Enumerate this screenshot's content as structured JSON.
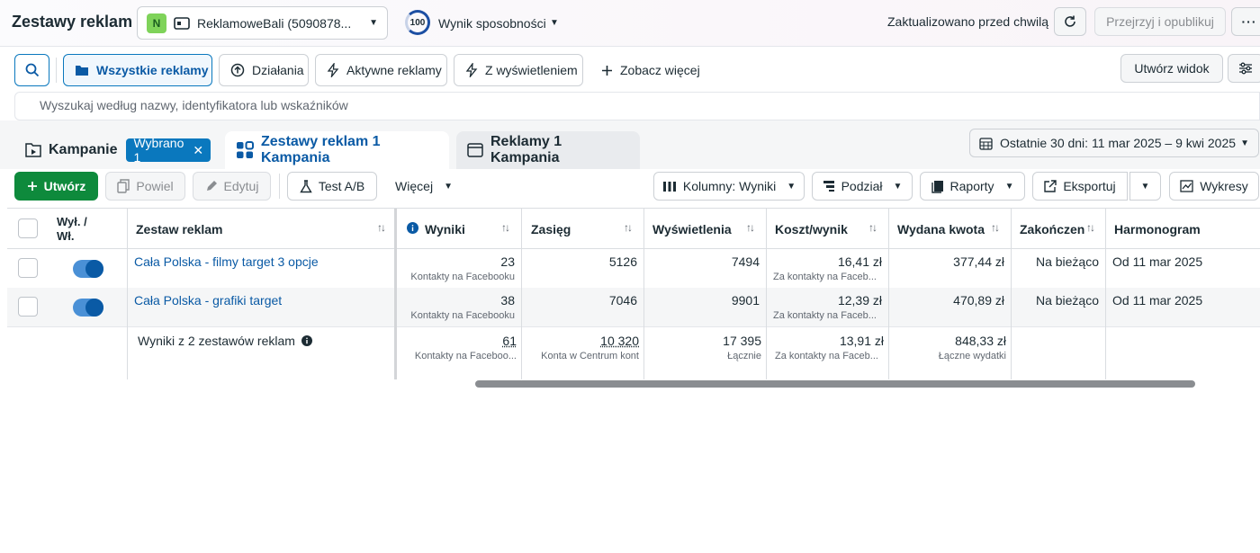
{
  "header": {
    "title": "Zestawy reklam",
    "account_badge": "N",
    "account_name": "ReklamoweBali (5090878...",
    "opportunity_score": "100",
    "opportunity_label": "Wynik sposobności",
    "updated_text": "Zaktualizowano przed chwilą",
    "publish_label": "Przejrzyj i opublikuj",
    "more_label": "···"
  },
  "filters": {
    "all_ads": "Wszystkie reklamy",
    "actions": "Działania",
    "active_ads": "Aktywne reklamy",
    "with_impressions": "Z wyświetleniem",
    "see_more": "Zobacz więcej",
    "create_view": "Utwórz widok"
  },
  "search": {
    "placeholder": "Wyszukaj według nazwy, identyfikatora lub wskaźników"
  },
  "tabs": {
    "campaigns": "Kampanie",
    "selected_chip": "Wybrano 1",
    "adsets": "Zestawy reklam 1 Kampania",
    "ads": "Reklamy 1 Kampania",
    "date_range": "Ostatnie 30 dni: 11 mar 2025 – 9 kwi 2025"
  },
  "toolbar": {
    "create": "Utwórz",
    "duplicate": "Powiel",
    "edit": "Edytuj",
    "ab_test": "Test A/B",
    "more": "Więcej",
    "columns": "Kolumny: Wyniki",
    "breakdown": "Podział",
    "reports": "Raporty",
    "export": "Eksportuj",
    "charts": "Wykresy"
  },
  "table": {
    "headers": {
      "onoff": "Wył. /\nWł.",
      "adset": "Zestaw reklam",
      "results": "Wyniki",
      "reach": "Zasięg",
      "impressions": "Wyświetlenia",
      "cost_per_result": "Koszt/wynik",
      "amount_spent": "Wydana kwota",
      "ends": "Zakończenie",
      "schedule": "Harmonogram"
    },
    "rows": [
      {
        "name": "Cała Polska - filmy target 3 opcje",
        "enabled": true,
        "results": "23",
        "results_sub": "Kontakty na Facebooku",
        "reach": "5126",
        "impressions": "7494",
        "cost_per_result": "16,41 zł",
        "cost_sub": "Za kontakty na Faceb...",
        "amount_spent": "377,44 zł",
        "ends": "Na bieżąco",
        "schedule": "Od 11 mar 2025"
      },
      {
        "name": "Cała Polska - grafiki target",
        "enabled": true,
        "results": "38",
        "results_sub": "Kontakty na Facebooku",
        "reach": "7046",
        "impressions": "9901",
        "cost_per_result": "12,39 zł",
        "cost_sub": "Za kontakty na Faceb...",
        "amount_spent": "470,89 zł",
        "ends": "Na bieżąco",
        "schedule": "Od 11 mar 2025"
      }
    ],
    "summary": {
      "label": "Wyniki z 2 zestawów reklam",
      "results": "61",
      "results_sub": "Kontakty na Faceboo...",
      "reach": "10 320",
      "reach_sub": "Konta w Centrum kont",
      "impressions": "17 395",
      "impressions_sub": "Łącznie",
      "cost_per_result": "13,91 zł",
      "cost_sub": "Za kontakty na Faceb...",
      "amount_spent": "848,33 zł",
      "amount_sub": "Łączne wydatki"
    }
  },
  "colors": {
    "primary_blue": "#0a78be",
    "link_blue": "#0a5aa5",
    "create_green": "#0e8a3c",
    "badge_green": "#7fd35a"
  },
  "icons": [
    "search-icon",
    "folder-icon",
    "arrow-up-circle-icon",
    "lightning-icon",
    "plus-icon",
    "filter-sliders-icon",
    "campaign-icon",
    "grid-icon",
    "ad-icon",
    "calendar-icon",
    "refresh-icon",
    "flask-icon",
    "pencil-icon",
    "copy-icon",
    "columns-icon",
    "breakdown-icon",
    "reports-icon",
    "export-icon",
    "chart-icon",
    "info-icon",
    "sort-icon"
  ]
}
